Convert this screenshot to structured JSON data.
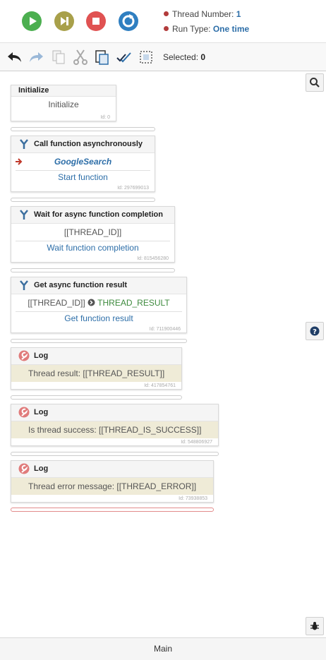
{
  "header": {
    "thread_number_label": "Thread Number:",
    "thread_number_value": "1",
    "run_type_label": "Run Type:",
    "run_type_value": "One time"
  },
  "toolbar": {
    "selected_label": "Selected:",
    "selected_value": "0"
  },
  "blocks": [
    {
      "title": "Initialize",
      "body": "Initialize",
      "id": "Id: 0"
    },
    {
      "title": "Call function asynchronously",
      "function_name": "GoogleSearch",
      "action": "Start function",
      "id": "Id: 297699013"
    },
    {
      "title": "Wait for async function completion",
      "body": "[[THREAD_ID]]",
      "action": "Wait function completion",
      "id": "Id: 815456280"
    },
    {
      "title": "Get async function result",
      "input": "[[THREAD_ID]]",
      "output": "THREAD_RESULT",
      "action": "Get function result",
      "id": "Id: 711900446"
    },
    {
      "title": "Log",
      "body": "Thread result: [[THREAD_RESULT]]",
      "id": "Id: 417854761"
    },
    {
      "title": "Log",
      "body": "Is thread success: [[THREAD_IS_SUCCESS]]",
      "id": "Id: 548806927"
    },
    {
      "title": "Log",
      "body": "Thread error message: [[THREAD_ERROR]]",
      "id": "Id: 73938853"
    }
  ],
  "footer": {
    "tab_label": "Main"
  },
  "icons": {
    "play": "play-icon",
    "next": "skip-next-icon",
    "stop": "stop-icon",
    "restart": "restart-icon",
    "undo": "undo-icon",
    "redo": "redo-icon",
    "copy": "copy-icon",
    "cut": "cut-icon",
    "paste": "paste-icon",
    "check_all": "check-all-icon",
    "select_area": "select-area-icon",
    "search": "search-icon",
    "help": "help-icon",
    "bug": "bug-icon"
  },
  "colors": {
    "play": "#4caf50",
    "next": "#a8a04a",
    "stop": "#e05252",
    "restart": "#2f7fc1",
    "accent_link": "#2d6ea8",
    "output_green": "#3d8a3d",
    "log_row_bg": "#efebd7"
  }
}
